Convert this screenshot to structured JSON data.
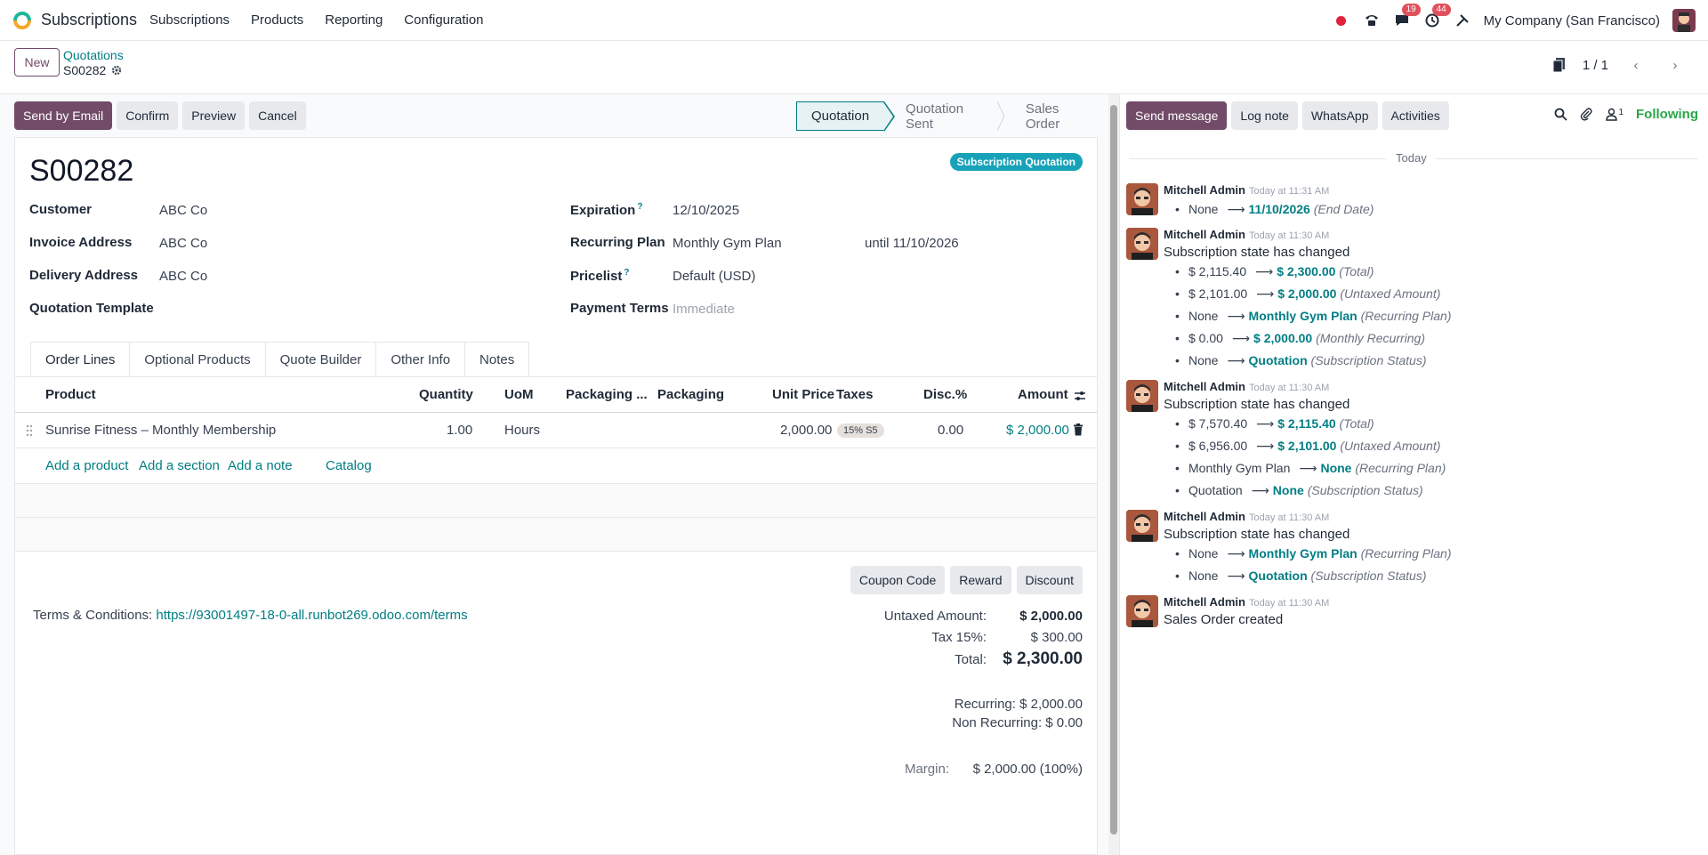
{
  "navbar": {
    "app_name": "Subscriptions",
    "menu": [
      "Subscriptions",
      "Products",
      "Reporting",
      "Configuration"
    ],
    "chat_badge": "19",
    "activity_badge": "44",
    "company": "My Company (San Francisco)"
  },
  "control_panel": {
    "new_label": "New",
    "breadcrumb_parent": "Quotations",
    "breadcrumb_current": "S00282",
    "pager": "1 / 1"
  },
  "actions": {
    "send_by_email": "Send by Email",
    "confirm": "Confirm",
    "preview": "Preview",
    "cancel": "Cancel"
  },
  "status_stages": [
    "Quotation",
    "Quotation Sent",
    "Sales Order"
  ],
  "form": {
    "name": "S00282",
    "badge": "Subscription Quotation",
    "customer_label": "Customer",
    "customer": "ABC Co",
    "invoice_address_label": "Invoice Address",
    "invoice_address": "ABC Co",
    "delivery_address_label": "Delivery Address",
    "delivery_address": "ABC Co",
    "quotation_template_label": "Quotation Template",
    "expiration_label": "Expiration",
    "expiration": "12/10/2025",
    "recurring_plan_label": "Recurring Plan",
    "recurring_plan": "Monthly Gym Plan",
    "until": "until 11/10/2026",
    "pricelist_label": "Pricelist",
    "pricelist": "Default (USD)",
    "payment_terms_label": "Payment Terms",
    "payment_terms_placeholder": "Immediate",
    "help_mark": "?"
  },
  "tabs": [
    "Order Lines",
    "Optional Products",
    "Quote Builder",
    "Other Info",
    "Notes"
  ],
  "order_lines": {
    "headers": {
      "product": "Product",
      "quantity": "Quantity",
      "uom": "UoM",
      "packaging_qty": "Packaging ...",
      "packaging": "Packaging",
      "unit_price": "Unit Price",
      "taxes": "Taxes",
      "disc": "Disc.%",
      "amount": "Amount"
    },
    "rows": [
      {
        "product": "Sunrise Fitness – Monthly Membership",
        "quantity": "1.00",
        "uom": "Hours",
        "unit_price": "2,000.00",
        "tax": "15% S5",
        "disc": "0.00",
        "amount": "$ 2,000.00"
      }
    ],
    "add_product": "Add a product",
    "add_section": "Add a section",
    "add_note": "Add a note",
    "catalog": "Catalog"
  },
  "summary": {
    "coupon_code": "Coupon Code",
    "reward": "Reward",
    "discount": "Discount",
    "terms_label": "Terms & Conditions:",
    "terms_link": "https://93001497-18-0-all.runbot269.odoo.com/terms",
    "untaxed_label": "Untaxed Amount:",
    "untaxed": "$ 2,000.00",
    "tax_label": "Tax 15%:",
    "tax": "$ 300.00",
    "total_label": "Total:",
    "total": "$ 2,300.00",
    "recurring": "Recurring: $ 2,000.00",
    "non_recurring": "Non Recurring: $ 0.00",
    "margin_label": "Margin:",
    "margin": "$ 2,000.00 (100%)"
  },
  "chatter": {
    "send_message": "Send message",
    "log_note": "Log note",
    "whatsapp": "WhatsApp",
    "activities": "Activities",
    "followers_count": "1",
    "following": "Following",
    "today": "Today",
    "messages": [
      {
        "author": "Mitchell Admin",
        "date": "Today at 11:31 AM",
        "changes": [
          {
            "old": "None",
            "new": "11/10/2026",
            "field": "(End Date)"
          }
        ]
      },
      {
        "author": "Mitchell Admin",
        "date": "Today at 11:30 AM",
        "body": "Subscription state has changed",
        "changes": [
          {
            "old": "$ 2,115.40",
            "new": "$ 2,300.00",
            "field": "(Total)"
          },
          {
            "old": "$ 2,101.00",
            "new": "$ 2,000.00",
            "field": "(Untaxed Amount)"
          },
          {
            "old": "None",
            "new": "Monthly Gym Plan",
            "field": "(Recurring Plan)"
          },
          {
            "old": "$ 0.00",
            "new": "$ 2,000.00",
            "field": "(Monthly Recurring)"
          },
          {
            "old": "None",
            "new": "Quotation",
            "field": "(Subscription Status)"
          }
        ]
      },
      {
        "author": "Mitchell Admin",
        "date": "Today at 11:30 AM",
        "body": "Subscription state has changed",
        "changes": [
          {
            "old": "$ 7,570.40",
            "new": "$ 2,115.40",
            "field": "(Total)"
          },
          {
            "old": "$ 6,956.00",
            "new": "$ 2,101.00",
            "field": "(Untaxed Amount)"
          },
          {
            "old": "Monthly Gym Plan",
            "new": "None",
            "field": "(Recurring Plan)"
          },
          {
            "old": "Quotation",
            "new": "None",
            "field": "(Subscription Status)"
          }
        ]
      },
      {
        "author": "Mitchell Admin",
        "date": "Today at 11:30 AM",
        "body": "Subscription state has changed",
        "changes": [
          {
            "old": "None",
            "new": "Monthly Gym Plan",
            "field": "(Recurring Plan)"
          },
          {
            "old": "None",
            "new": "Quotation",
            "field": "(Subscription Status)"
          }
        ]
      },
      {
        "author": "Mitchell Admin",
        "date": "Today at 11:30 AM",
        "body": "Sales Order created",
        "changes": []
      }
    ]
  },
  "colors": {
    "primary": "#714b67",
    "link": "#017e84",
    "badge_teal": "#17a2b8",
    "following_green": "#28a745"
  }
}
